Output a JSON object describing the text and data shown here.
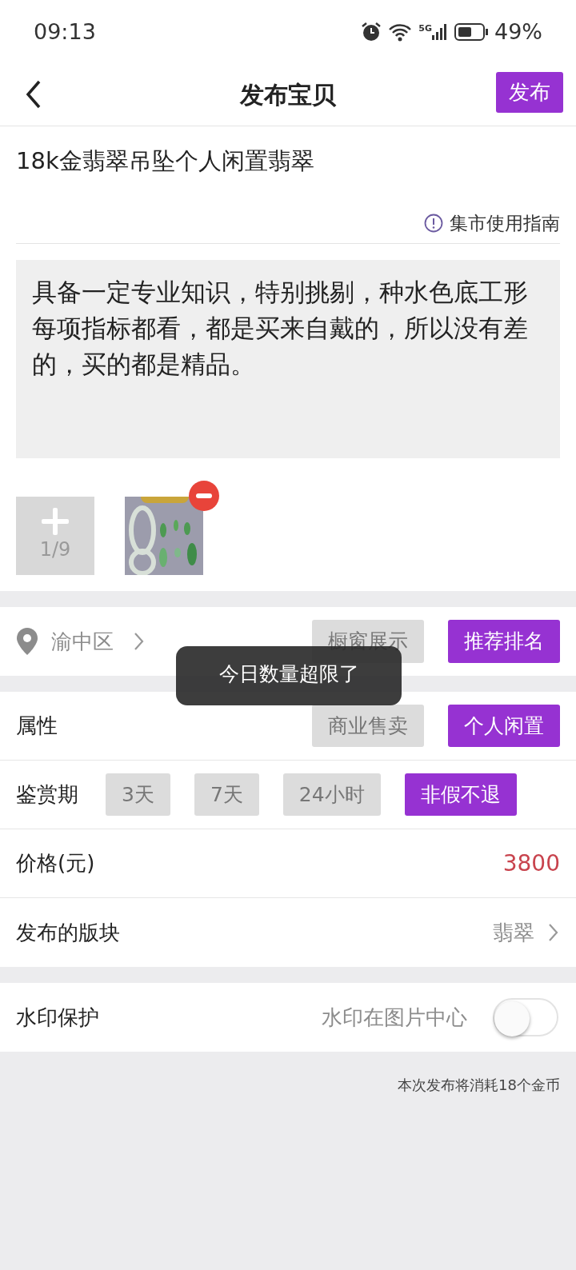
{
  "status_bar": {
    "time": "09:13",
    "network": "5G",
    "battery": "49%"
  },
  "header": {
    "title": "发布宝贝",
    "publish_button": "发布"
  },
  "title_field": {
    "value": "18k金翡翠吊坠个人闲置翡翠"
  },
  "guide_link": "集市使用指南",
  "description": {
    "value": "具备一定专业知识，特别挑剔，种水色底工形每项指标都看，都是买来自戴的，所以没有差的，买的都是精品。"
  },
  "photos": {
    "counter": "1/9",
    "items": [
      {
        "kind": "picture",
        "removable": true
      }
    ]
  },
  "location": {
    "label": "渝中区",
    "options": [
      {
        "label": "橱窗展示",
        "selected": false
      },
      {
        "label": "推荐排名",
        "selected": true
      }
    ]
  },
  "rows": [
    {
      "kind": "options",
      "label": "属性",
      "options": [
        {
          "label": "商业售卖",
          "selected": false
        },
        {
          "label": "个人闲置",
          "selected": true
        }
      ]
    },
    {
      "kind": "options",
      "label": "鉴赏期",
      "options": [
        {
          "label": "3天",
          "selected": false
        },
        {
          "label": "7天",
          "selected": false
        },
        {
          "label": "24小时",
          "selected": false
        },
        {
          "label": "非假不退",
          "selected": true
        }
      ]
    },
    {
      "kind": "value",
      "label": "价格(元)",
      "value": "3800"
    },
    {
      "kind": "link",
      "label": "发布的版块",
      "value": "翡翠"
    }
  ],
  "watermark": {
    "label": "水印保护",
    "hint": "水印在图片中心",
    "on": false
  },
  "cost_note": "本次发布将消耗18个金币",
  "toast": "今日数量超限了"
}
